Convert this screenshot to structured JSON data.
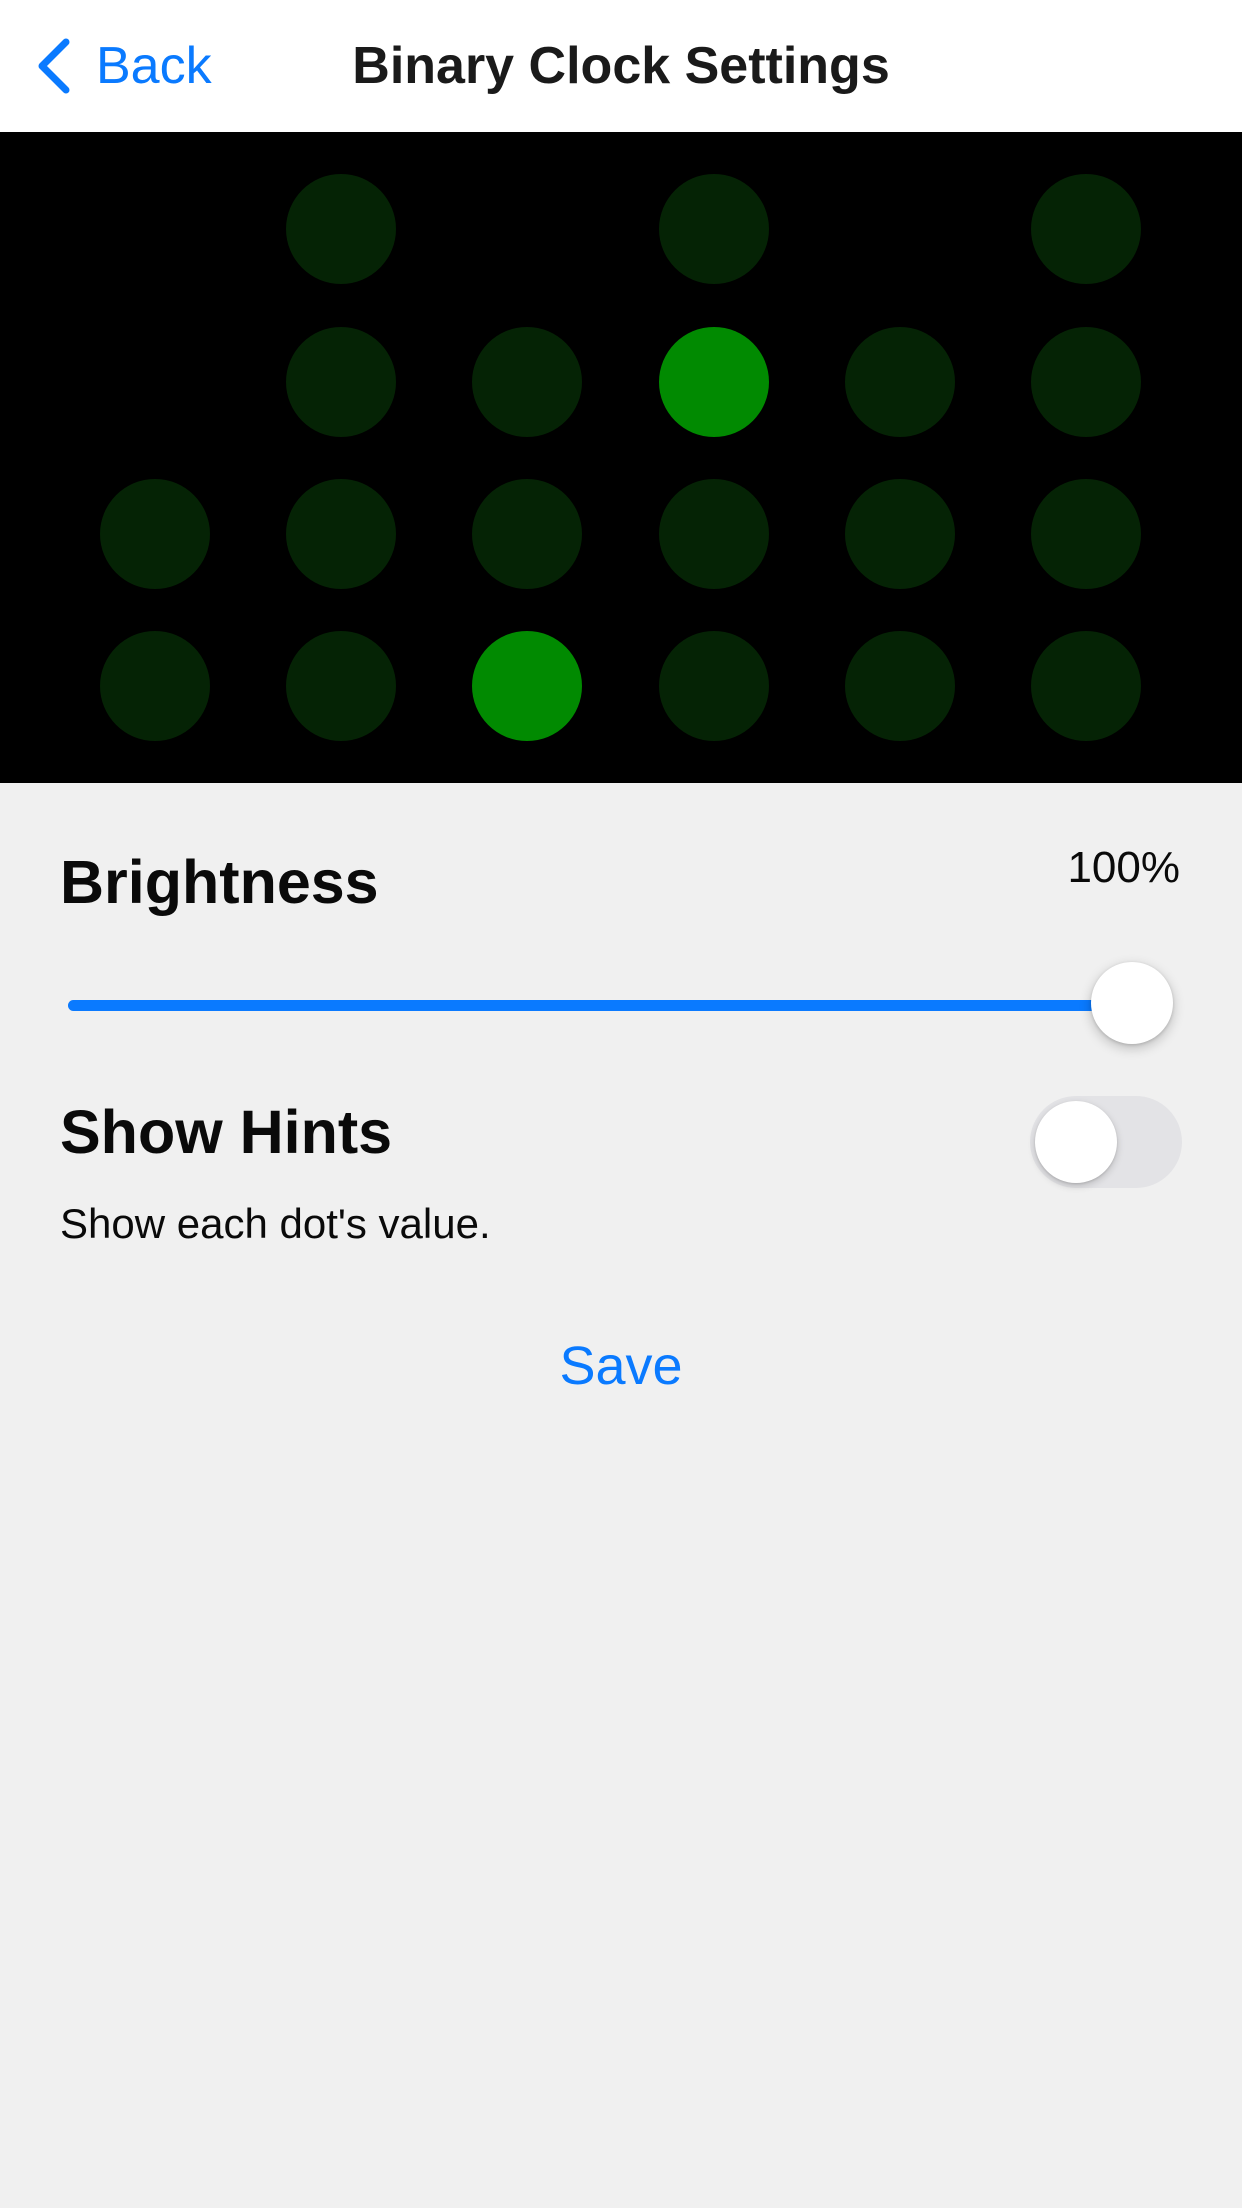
{
  "nav": {
    "back_label": "Back",
    "title": "Binary Clock Settings"
  },
  "clock": {
    "colors": {
      "on": "#018a01",
      "off": "#052305",
      "background": "#000000"
    },
    "columns": [
      [
        null,
        null,
        "off",
        "off"
      ],
      [
        "off",
        "off",
        "off",
        "off"
      ],
      [
        null,
        "off",
        "off",
        "on"
      ],
      [
        "off",
        "on",
        "off",
        "off"
      ],
      [
        null,
        "off",
        "off",
        "off"
      ],
      [
        "off",
        "off",
        "off",
        "off"
      ]
    ]
  },
  "brightness": {
    "label": "Brightness",
    "value_text": "100%",
    "value": 1.0,
    "accent": "#0a7aff"
  },
  "hints": {
    "label": "Show Hints",
    "description": "Show each dot's value.",
    "enabled": false
  },
  "save_label": "Save",
  "icons": {
    "back": "chevron-left-icon"
  }
}
